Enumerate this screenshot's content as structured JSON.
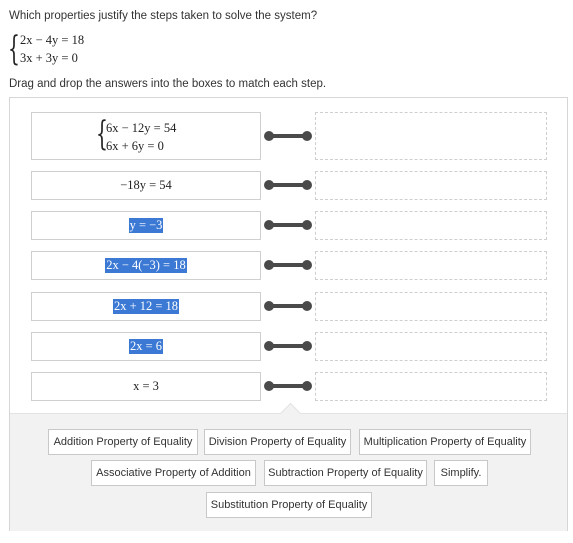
{
  "question": "Which properties justify the steps taken to solve the system?",
  "system": {
    "line1": "2x − 4y = 18",
    "line2": "3x + 3y = 0"
  },
  "instructions": "Drag and drop the answers into the boxes to match each step.",
  "steps": [
    {
      "line1": "6x − 12y = 54",
      "line2": "6x + 6y = 0"
    },
    {
      "text": "−18y = 54"
    },
    {
      "text": "y = −3"
    },
    {
      "text": "2x − 4(−3) = 18"
    },
    {
      "text": "2x + 12 = 18"
    },
    {
      "text": "2x = 6"
    },
    {
      "text": "x = 3"
    }
  ],
  "answers": [
    "Addition Property of Equality",
    "Division Property of Equality",
    "Multiplication Property of Equality",
    "Associative Property of Addition",
    "Subtraction Property of Equality",
    "Simplify.",
    "Substitution Property of Equality"
  ],
  "colors": {
    "highlight": "#3b79d4",
    "connector": "#4a4a4a",
    "bank_background": "#f2f2f2"
  }
}
